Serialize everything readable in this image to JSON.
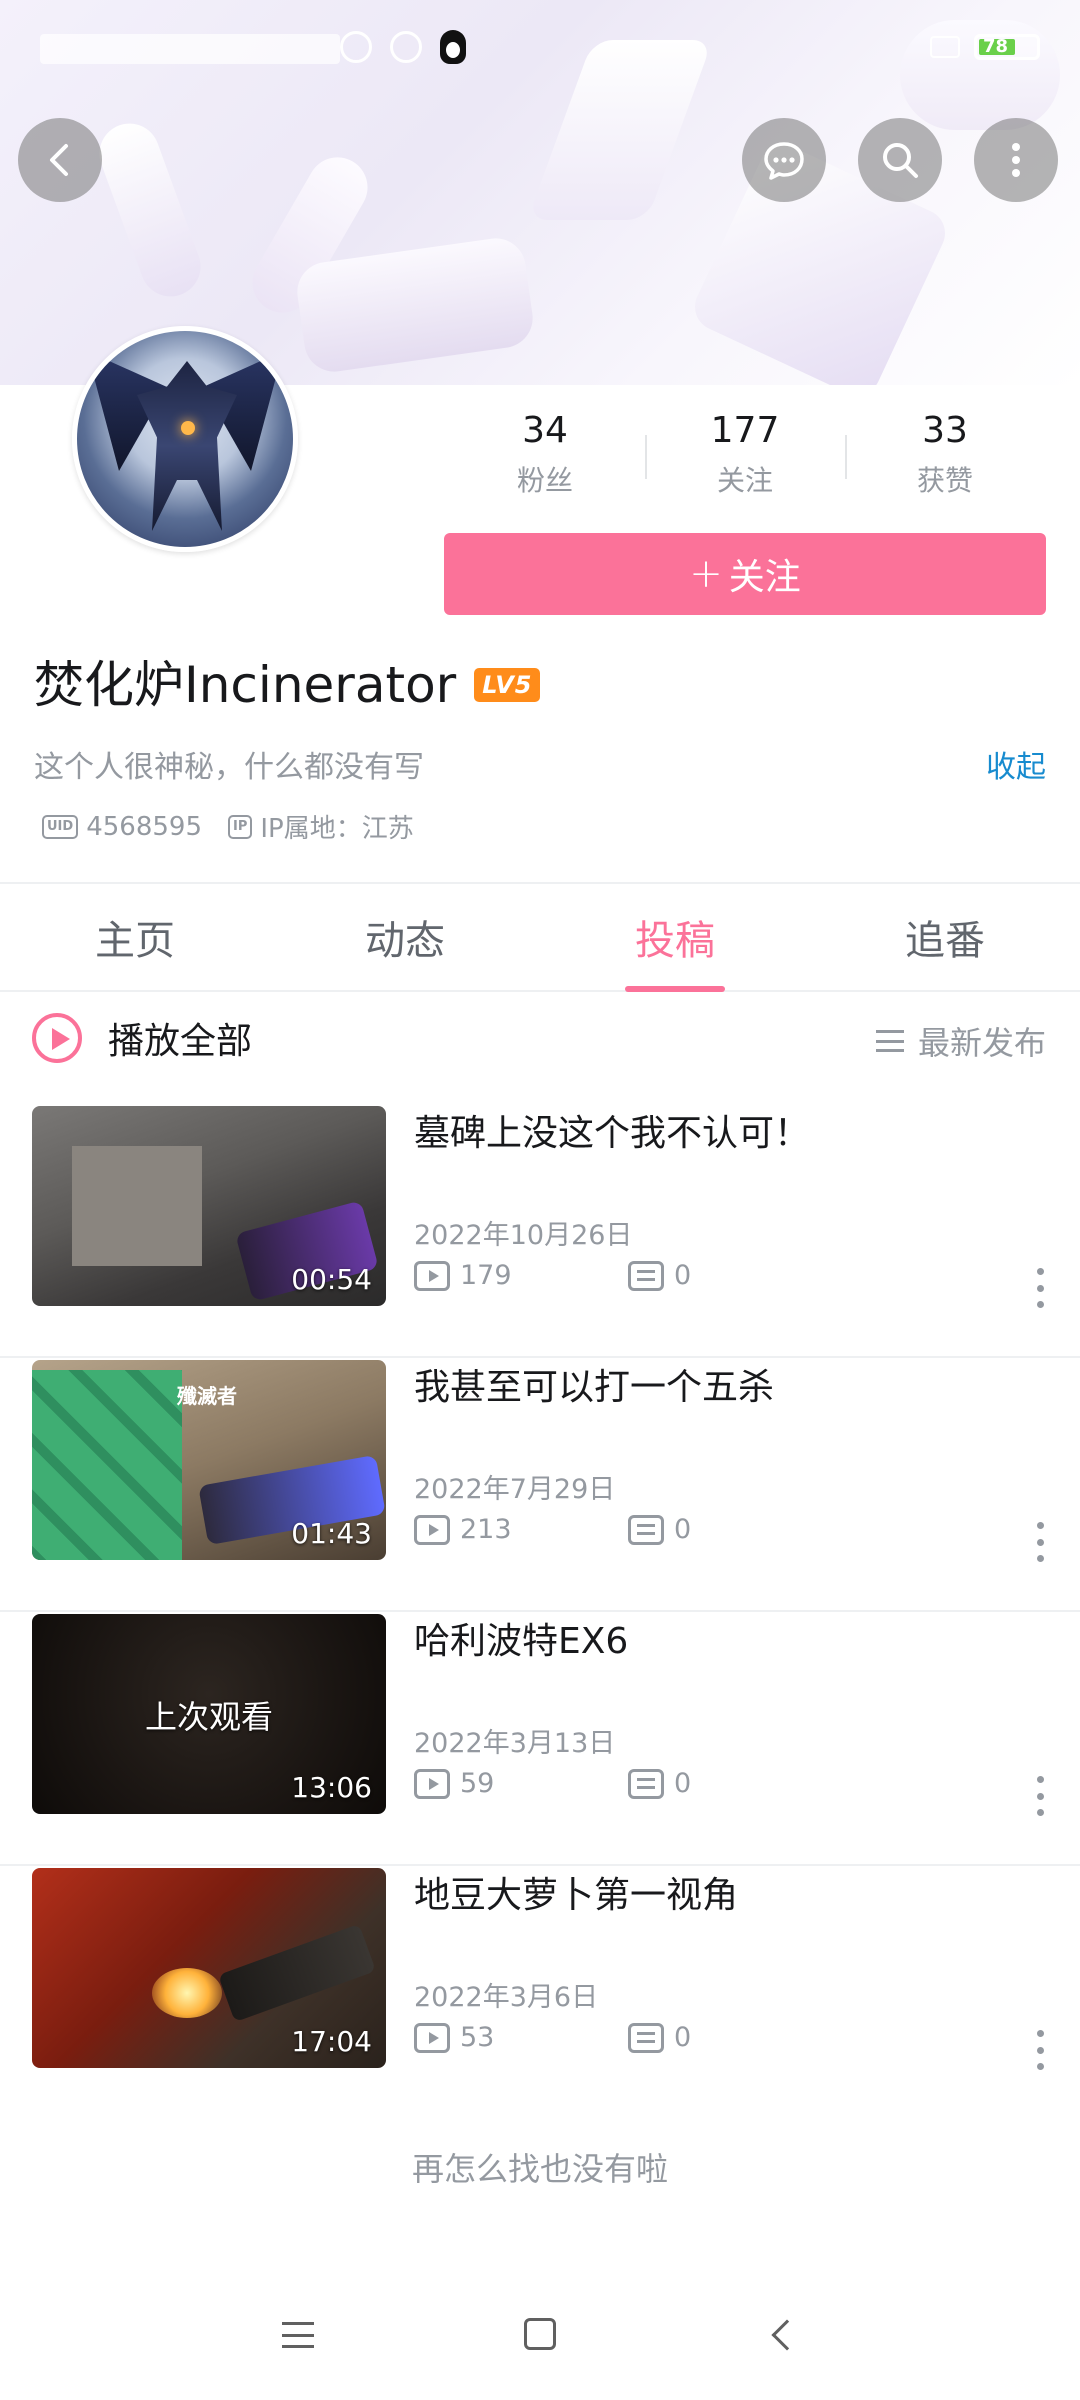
{
  "status_bar": {
    "battery": "78"
  },
  "header": {
    "back_icon": "back-arrow-icon",
    "message_icon": "chat-bubble-icon",
    "search_icon": "search-icon",
    "more_icon": "more-vertical-icon"
  },
  "profile": {
    "stats": [
      {
        "value": "34",
        "label": "粉丝"
      },
      {
        "value": "177",
        "label": "关注"
      },
      {
        "value": "33",
        "label": "获赞"
      }
    ],
    "follow_label": "关注",
    "username": "焚化炉Incinerator",
    "level": "LV5",
    "bio": "这个人很神秘，什么都没有写",
    "collapse_label": "收起",
    "uid": "4568595",
    "ip_location": "IP属地：江苏",
    "uid_badge": "UID",
    "ip_badge": "IP"
  },
  "tabs": [
    {
      "label": "主页",
      "active": false
    },
    {
      "label": "动态",
      "active": false
    },
    {
      "label": "投稿",
      "active": true
    },
    {
      "label": "追番",
      "active": false
    }
  ],
  "list_header": {
    "play_all_label": "播放全部",
    "sort_label": "最新发布"
  },
  "videos": [
    {
      "title": "墓碑上没这个我不认可！",
      "date": "2022年10月26日",
      "plays": "179",
      "danmaku": "0",
      "duration": "00:54"
    },
    {
      "title": "我甚至可以打一个五杀",
      "date": "2022年7月29日",
      "plays": "213",
      "danmaku": "0",
      "duration": "01:43",
      "thumb_tag": "殲滅者"
    },
    {
      "title": "哈利波特EX6",
      "date": "2022年3月13日",
      "plays": "59",
      "danmaku": "0",
      "duration": "13:06",
      "watched_label": "上次观看"
    },
    {
      "title": "地豆大萝卜第一视角",
      "date": "2022年3月6日",
      "plays": "53",
      "danmaku": "0",
      "duration": "17:04"
    }
  ],
  "end_note": "再怎么找也没有啦",
  "colors": {
    "accent": "#fb7299",
    "link": "#178bcf",
    "level_badge": "#ff8c1a"
  }
}
